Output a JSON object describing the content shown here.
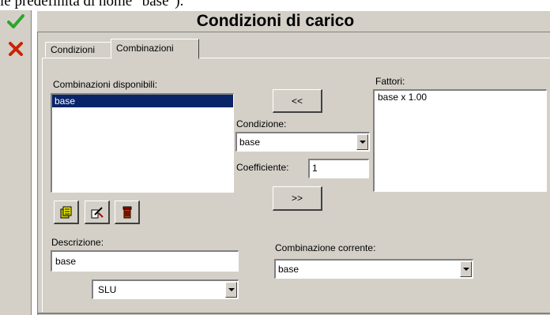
{
  "top_caption": "le predefinita di nome \"base\").",
  "toolbar": {
    "confirm_icon": "check-icon",
    "cancel_icon": "close-icon",
    "confirm_color": "#2aa52a",
    "cancel_color": "#cc2200"
  },
  "title": "Condizioni di carico",
  "tabs": [
    {
      "label": "Condizioni",
      "active": false
    },
    {
      "label": "Combinazioni",
      "active": true
    }
  ],
  "combinations": {
    "label": "Combinazioni disponibili:",
    "items": [
      {
        "label": "base",
        "selected": true
      }
    ]
  },
  "buttons": {
    "move_left": "<<",
    "move_right": ">>"
  },
  "condition": {
    "label": "Condizione:",
    "value": "base"
  },
  "coefficient": {
    "label": "Coefficiente:",
    "value": "1"
  },
  "factors": {
    "label": "Fattori:",
    "items": [
      "base x 1.00"
    ]
  },
  "icon_buttons": [
    {
      "name": "new-combination-icon"
    },
    {
      "name": "edit-combination-icon"
    },
    {
      "name": "delete-trash-icon"
    }
  ],
  "description": {
    "label": "Descrizione:",
    "value": "base"
  },
  "limit_state": {
    "value": "SLU"
  },
  "current_combination": {
    "label": "Combinazione corrente:",
    "value": "base"
  }
}
